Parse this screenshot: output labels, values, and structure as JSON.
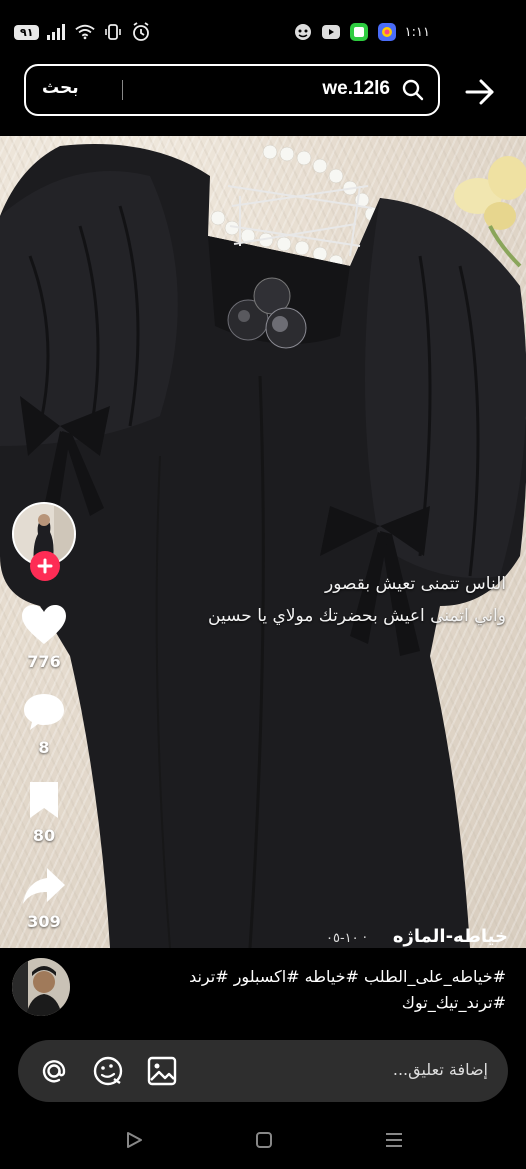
{
  "status_bar": {
    "battery": "٩١",
    "time": "١:١١"
  },
  "search": {
    "button_label": "بحث",
    "query": "we.12l6"
  },
  "video": {
    "overlay_line1": "الناس تتمنى تعيش بقصور",
    "overlay_line2": "واني اتمنى اعيش بحضرتك مولاي يا حسين",
    "author": "خياطه-الماژه",
    "date": "١٠-٠٥ ·"
  },
  "actions": {
    "likes": "776",
    "comments": "8",
    "saves": "80",
    "shares": "309"
  },
  "comment_preview": {
    "text": "#خياطه_على_الطلب #خياطه #اكسبلور #ترند #ترند_تيك_توك"
  },
  "comment_input": {
    "placeholder": "إضافة تعليق..."
  },
  "colors": {
    "follow_accent": "#fe2c55",
    "background": "#000000"
  }
}
